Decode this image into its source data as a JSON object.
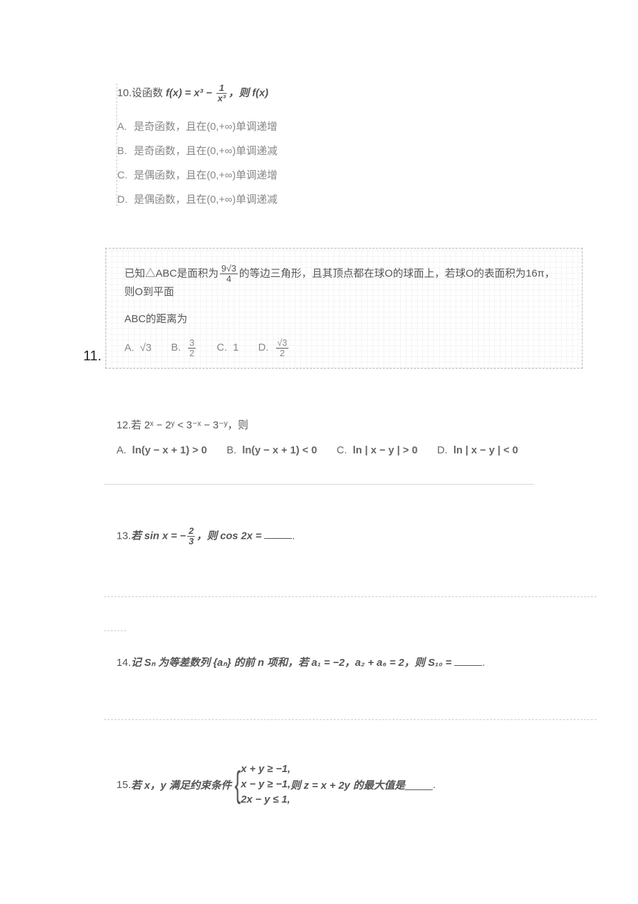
{
  "q10": {
    "number": "10.",
    "stem_prefix": "设函数 ",
    "stem_func": "f(x) = x³ − ",
    "stem_frac_num": "1",
    "stem_frac_den": "x³",
    "stem_suffix": "，则 f(x)",
    "opts": {
      "A": "是奇函数，且在(0,+∞)单调递增",
      "B": "是奇函数，且在(0,+∞)单调递减",
      "C": "是偶函数，且在(0,+∞)单调递增",
      "D": "是偶函数，且在(0,+∞)单调递减"
    }
  },
  "q11": {
    "number": "11.",
    "line1_a": "已知△ABC是面积为",
    "line1_frac_num": "9√3",
    "line1_frac_den": "4",
    "line1_b": "的等边三角形，且其顶点都在球O的球面上，若球O的表面积为16π，则O到平面",
    "line2": "ABC的距离为",
    "optA": "√3",
    "optB_num": "3",
    "optB_den": "2",
    "optC": "1",
    "optD_num": "√3",
    "optD_den": "2",
    "letters": {
      "A": "A.",
      "B": "B.",
      "C": "C.",
      "D": "D."
    }
  },
  "q12": {
    "number": "12.",
    "stem": "若 2ˣ − 2ʸ < 3⁻ˣ − 3⁻ʸ，则",
    "opts": {
      "A": "ln(y − x + 1) > 0",
      "B": "ln(y − x + 1) < 0",
      "C": "ln | x − y | > 0",
      "D": "ln | x − y | < 0"
    },
    "letters": {
      "A": "A.",
      "B": "B.",
      "C": "C.",
      "D": "D."
    }
  },
  "q13": {
    "number": "13.",
    "text_a": "若 sin x = −",
    "frac_num": "2",
    "frac_den": "3",
    "text_b": "，则 cos 2x = ",
    "tail": "."
  },
  "q14": {
    "number": "14.",
    "text_a": "记 Sₙ 为等差数列 {aₙ} 的前 n 项和，若 a₁ = −2，a₂ + a₆ = 2，则 S₁₀ = ",
    "tail": "."
  },
  "q15": {
    "number": "15.",
    "text_a": "若 x，y 满足约束条件",
    "c1": "x + y ≥ −1,",
    "c2": "x − y ≥ −1,",
    "c3": "2x − y ≤ 1,",
    "text_b": "则 z = x + 2y 的最大值是",
    "tail": "."
  }
}
